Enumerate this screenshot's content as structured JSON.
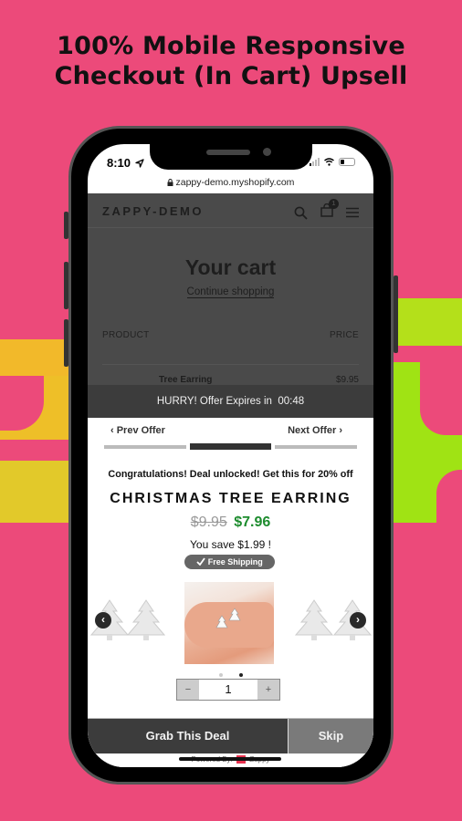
{
  "headline": {
    "line1": "100% Mobile Responsive",
    "line2": "Checkout (In Cart) Upsell"
  },
  "colors": {
    "background": "#ec4a7a",
    "accent_yellow": "#f2b92a",
    "accent_green": "#a2e216",
    "price_green": "#1d8c2e"
  },
  "status_bar": {
    "time": "8:10",
    "location_icon": "location-arrow-icon",
    "signal_icon": "cellular-signal-icon",
    "wifi_icon": "wifi-icon",
    "battery_icon": "battery-icon"
  },
  "browser": {
    "lock_icon": "lock-icon",
    "url": "zappy-demo.myshopify.com"
  },
  "store": {
    "logo": "ZAPPY-DEMO",
    "cart_count": "1",
    "cart_title": "Your cart",
    "continue_link": "Continue shopping",
    "columns": {
      "product": "PRODUCT",
      "price": "PRICE"
    },
    "item": {
      "name": "Tree Earring",
      "price": "$9.95"
    }
  },
  "timer": {
    "label": "HURRY! Offer Expires in",
    "value": "00:48"
  },
  "upsell": {
    "prev_label": "‹ Prev Offer",
    "next_label": "Next Offer ›",
    "offer_total": 3,
    "offer_current": 2,
    "congrats": "Congratulations! Deal unlocked! Get this for 20% off",
    "product_title": "CHRISTMAS TREE EARRING",
    "old_price": "$9.95",
    "new_price": "$7.96",
    "savings": "You save $1.99 !",
    "shipping_badge": "Free Shipping",
    "carousel_prev": "‹",
    "carousel_next": "›",
    "image_count": 2,
    "image_active": 2,
    "quantity": {
      "minus": "−",
      "value": "1",
      "plus": "+"
    },
    "grab_label": "Grab This Deal",
    "skip_label": "Skip",
    "powered_by": "Powered By:",
    "powered_brand": "Zappy"
  }
}
